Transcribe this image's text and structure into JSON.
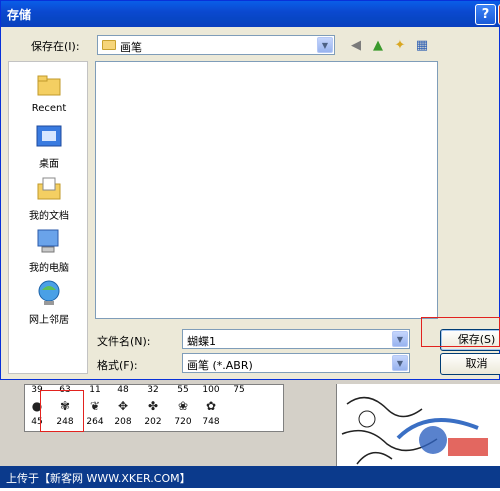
{
  "dialog": {
    "title": "存储",
    "help_icon": "?",
    "close_icon": "×",
    "save_in_label": "保存在(I):",
    "save_in_value": "画笔",
    "nav_icons": [
      "back-icon",
      "up-folder-icon",
      "new-folder-icon",
      "view-menu-icon"
    ],
    "places": [
      {
        "label": "Recent",
        "icon": "recent-folder-icon"
      },
      {
        "label": "桌面",
        "icon": "desktop-icon"
      },
      {
        "label": "我的文档",
        "icon": "my-documents-icon"
      },
      {
        "label": "我的电脑",
        "icon": "my-computer-icon"
      },
      {
        "label": "网上邻居",
        "icon": "network-icon"
      }
    ],
    "filename_label": "文件名(N):",
    "filename_value": "蝴蝶1",
    "format_label": "格式(F):",
    "format_value": "画笔 (*.ABR)",
    "save_button": "保存(S)",
    "cancel_button": "取消"
  },
  "brush_panel": {
    "top_numbers": [
      "39",
      "63",
      "11",
      "48",
      "32",
      "55",
      "100",
      "75"
    ],
    "bottom_numbers": [
      "45",
      "248",
      "264",
      "208",
      "202",
      "720",
      "748"
    ]
  },
  "footer": {
    "text": "上传于【新客网 WWW.XKER.COM】"
  },
  "colors": {
    "titlebar": "#0a5ee8",
    "dialog_bg": "#ece9d8",
    "highlight_red": "#e2221e"
  }
}
